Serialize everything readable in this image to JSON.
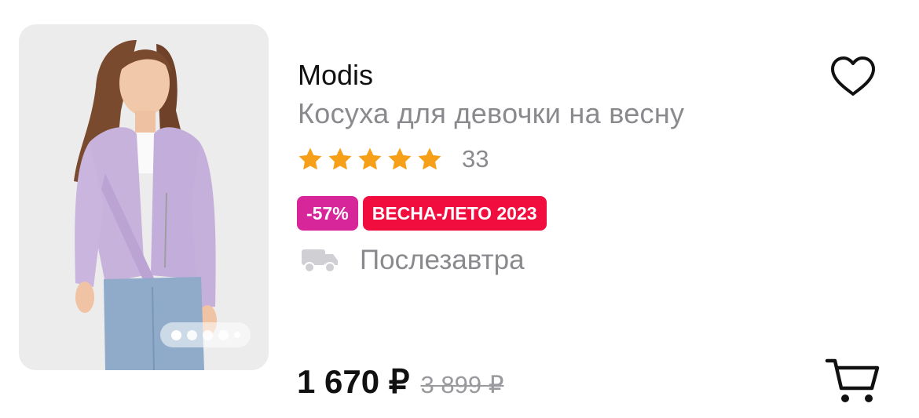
{
  "product": {
    "brand": "Modis",
    "name": "Косуха для девочки на весну",
    "rating": 5,
    "rating_count": "33",
    "badges": {
      "discount": "-57%",
      "season": "ВЕСНА-ЛЕТО 2023"
    },
    "delivery": "Послезавтра",
    "price": "1 670 ₽",
    "old_price": "3 899 ₽"
  },
  "gallery": {
    "image_count": 5,
    "active_index": 0
  },
  "icons": {
    "favorite": "heart-outline-icon",
    "cart": "cart-icon",
    "delivery": "truck-icon",
    "star": "star-icon"
  },
  "colors": {
    "star": "#f6a01a",
    "discount_badge": "#d7259a",
    "season_badge": "#f20d3f",
    "muted_text": "#8a8a8e"
  }
}
